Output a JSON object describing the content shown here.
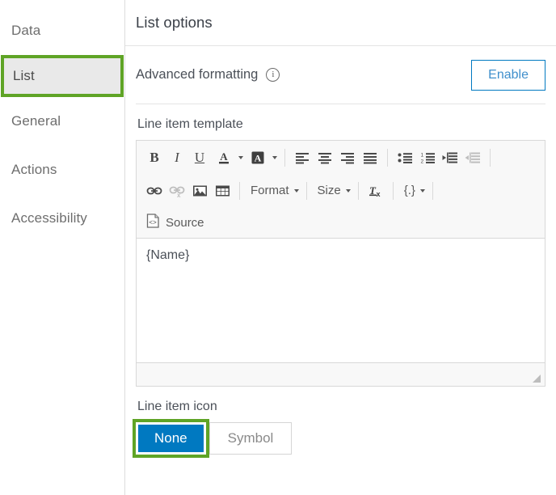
{
  "sidebar": {
    "items": [
      {
        "label": "Data",
        "name": "sidebar-item-data",
        "active": false
      },
      {
        "label": "List",
        "name": "sidebar-item-list",
        "active": true
      },
      {
        "label": "General",
        "name": "sidebar-item-general",
        "active": false
      },
      {
        "label": "Actions",
        "name": "sidebar-item-actions",
        "active": false
      },
      {
        "label": "Accessibility",
        "name": "sidebar-item-accessibility",
        "active": false
      }
    ],
    "active_item": "List",
    "highlight_color": "#5fa426"
  },
  "header": {
    "title": "List options"
  },
  "advanced_formatting": {
    "label": "Advanced formatting",
    "info_icon": "info-icon",
    "info_glyph": "i",
    "enable_label": "Enable",
    "enable_color": "#0079c1"
  },
  "line_item_template": {
    "label": "Line item template",
    "content": "{Name}",
    "toolbar": {
      "row1": [
        {
          "type": "icon",
          "name": "bold-icon",
          "glyph": "B",
          "disabled": false
        },
        {
          "type": "icon",
          "name": "italic-icon",
          "glyph": "I",
          "disabled": false
        },
        {
          "type": "icon",
          "name": "underline-icon",
          "glyph": "U",
          "disabled": false
        },
        {
          "type": "combo",
          "name": "text-color-icon",
          "glyph": "A",
          "disabled": false
        },
        {
          "type": "combo",
          "name": "background-color-icon",
          "glyph": "A",
          "disabled": false
        },
        {
          "type": "sep",
          "name": "toolbar-separator"
        },
        {
          "type": "icon",
          "name": "align-left-icon",
          "disabled": false
        },
        {
          "type": "icon",
          "name": "align-center-icon",
          "disabled": false
        },
        {
          "type": "icon",
          "name": "align-right-icon",
          "disabled": false
        },
        {
          "type": "icon",
          "name": "align-justify-icon",
          "disabled": false
        },
        {
          "type": "sep",
          "name": "toolbar-separator"
        },
        {
          "type": "icon",
          "name": "bulleted-list-icon",
          "disabled": false
        },
        {
          "type": "icon",
          "name": "numbered-list-icon",
          "disabled": false
        },
        {
          "type": "icon",
          "name": "increase-indent-icon",
          "disabled": false
        },
        {
          "type": "icon",
          "name": "decrease-indent-icon",
          "disabled": true
        },
        {
          "type": "sep",
          "name": "toolbar-separator"
        }
      ],
      "row2": [
        {
          "type": "icon",
          "name": "link-icon",
          "disabled": false
        },
        {
          "type": "icon",
          "name": "unlink-icon",
          "disabled": true
        },
        {
          "type": "icon",
          "name": "image-icon",
          "disabled": false
        },
        {
          "type": "icon",
          "name": "table-icon",
          "disabled": false
        },
        {
          "type": "sep",
          "name": "toolbar-separator"
        },
        {
          "type": "text",
          "name": "format-dropdown",
          "label": "Format",
          "disabled": false
        },
        {
          "type": "sep",
          "name": "toolbar-separator"
        },
        {
          "type": "text",
          "name": "size-dropdown",
          "label": "Size",
          "disabled": false
        },
        {
          "type": "sep",
          "name": "toolbar-separator"
        },
        {
          "type": "icon",
          "name": "remove-format-icon",
          "disabled": false
        },
        {
          "type": "sep",
          "name": "toolbar-separator"
        },
        {
          "type": "combo",
          "name": "insert-field-icon",
          "glyph": "{.}",
          "disabled": false
        },
        {
          "type": "sep",
          "name": "toolbar-separator"
        }
      ],
      "row3_source_label": "Source"
    }
  },
  "line_item_icon": {
    "label": "Line item icon",
    "options": [
      {
        "label": "None",
        "name": "line-item-icon-none-button",
        "selected": true
      },
      {
        "label": "Symbol",
        "name": "line-item-icon-symbol-button",
        "selected": false
      }
    ],
    "selected": "None",
    "selected_color": "#0079c1",
    "focus_color": "#5fa426"
  }
}
